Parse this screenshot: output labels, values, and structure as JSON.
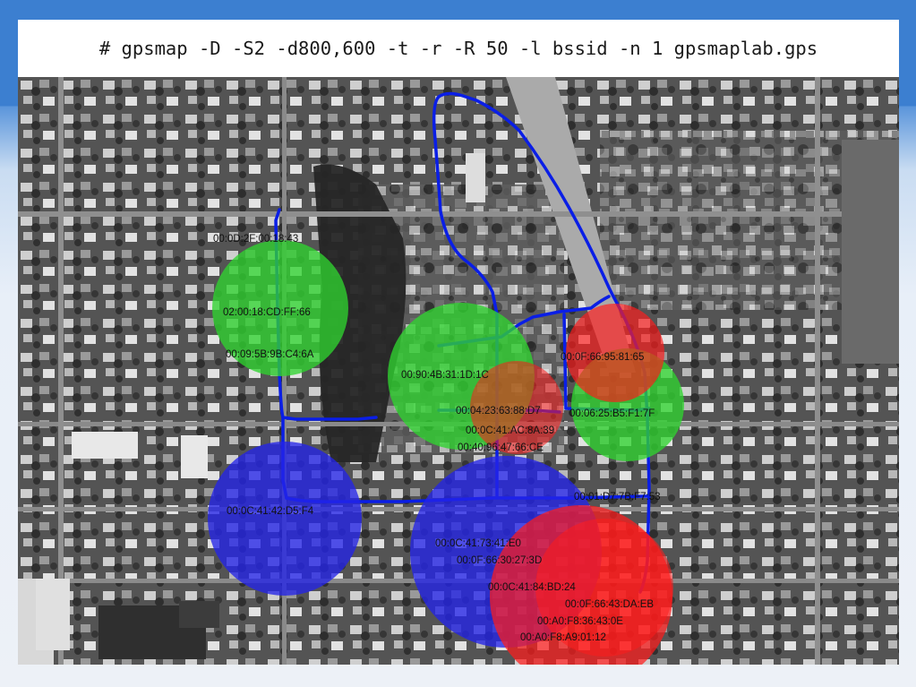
{
  "slide": {
    "command": "# gpsmap -D -S2 -d800,600 -t -r -R 50 -l bssid -n 1 gpsmaplab.gps",
    "background": "aerial-satellite-map",
    "colors": {
      "header_blue": "#3c7fd0",
      "track_blue": "#0a1ee6",
      "circle_green": "#2fd32f",
      "circle_blue": "#2424e8",
      "circle_red": "#ff1c1c"
    }
  },
  "labels": [
    "00:0D:2F:00:18:43",
    "02:00:18:CD:FF:66",
    "00:09:5B:9B:C4:6A",
    "00:90:4B:31:1D:1C",
    "00:0F:66:95:81:65",
    "00:04:23:63:88:D7",
    "00:06:25:B5:F1:7F",
    "00:0C:41:AC:8A:39",
    "00:40:96:47:66:CE",
    "00:0C:41:42:D5:F4",
    "00:01:D7:7B:F7:53",
    "00:0C:41:73:41:E0",
    "00:0F:66:30:27:3D",
    "00:0C:41:84:BD:24",
    "00:0F:66:43:DA:EB",
    "00:A0:F8:36:43:0E",
    "00:A0:F8:A9:01:12"
  ]
}
